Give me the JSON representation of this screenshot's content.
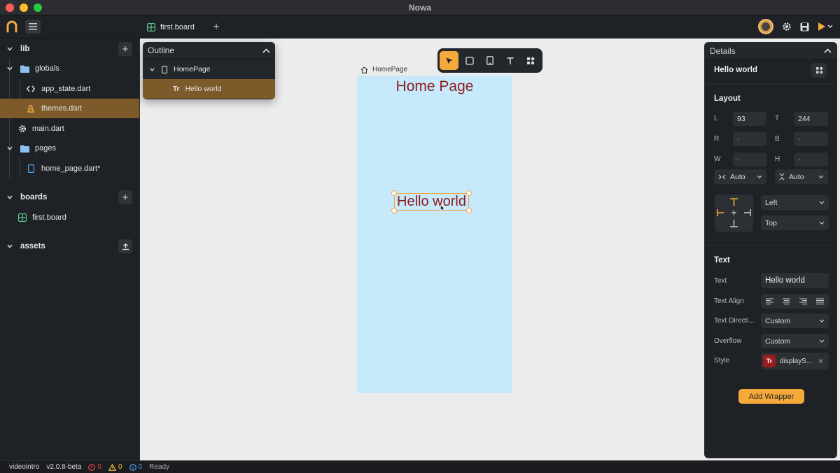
{
  "window": {
    "title": "Nowa"
  },
  "toolbar": {
    "tab_label": "first.board"
  },
  "sidebar": {
    "lib_label": "lib",
    "globals_label": "globals",
    "app_state_label": "app_state.dart",
    "themes_label": "themes.dart",
    "main_label": "main.dart",
    "pages_label": "pages",
    "home_page_label": "home_page.dart*",
    "boards_label": "boards",
    "first_board_label": "first.board",
    "assets_label": "assets"
  },
  "outline": {
    "title": "Outline",
    "page_label": "HomePage",
    "text_label": "Hello world"
  },
  "canvas": {
    "page_label": "HomePage",
    "home_title": "Home Page",
    "hello_text": "Hello world"
  },
  "details": {
    "title": "Details",
    "selected_name": "Hello world",
    "layout_title": "Layout",
    "l_label": "L",
    "l_value": "93",
    "t_label": "T",
    "t_value": "244",
    "r_label": "R",
    "r_value": "-",
    "b_label": "B",
    "b_value": "-",
    "w_label": "W",
    "w_value": "-",
    "h_label": "H",
    "h_value": "-",
    "width_mode": "Auto",
    "height_mode": "Auto",
    "h_align": "Left",
    "v_align": "Top",
    "text_title": "Text",
    "text_label": "Text",
    "text_value": "Hello world",
    "text_align_label": "Text Align",
    "text_direction_label": "Text Directi...",
    "text_direction_value": "Custom",
    "overflow_label": "Overflow",
    "overflow_value": "Custom",
    "style_label": "Style",
    "style_value": "displayS...",
    "style_icon_text": "Tr",
    "add_wrapper_label": "Add Wrapper"
  },
  "statusbar": {
    "project": "videointro",
    "version": "v2.0.8-beta",
    "errors": "0",
    "warnings": "0",
    "infos": "0",
    "status": "Ready"
  },
  "colors": {
    "accent": "#f6a93b",
    "selection": "#7d5a2a",
    "text_red": "#8c1c1c",
    "phone_bg": "#c6eafb"
  }
}
